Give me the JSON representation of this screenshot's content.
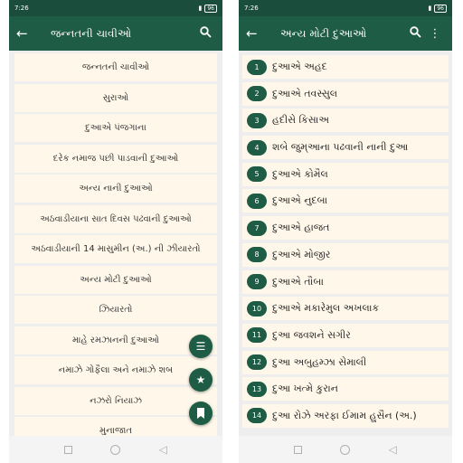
{
  "colors": {
    "primary": "#1e5c46",
    "statusbar": "#1a4d3c",
    "row_bg": "#fff8ea"
  },
  "left": {
    "status": {
      "time": "7:26",
      "battery": "96"
    },
    "title": "જન્નતની ચાવીઓ",
    "icons": {
      "back": "arrow-left-icon",
      "search": "search-icon"
    },
    "items": [
      "જન્નતની ચાવીઓ",
      "સુરાઓ",
      "દુઆએ પંજગાના",
      "દરેક નમાજ પછી પાડવાની દુઆઓ",
      "અન્ય નાની દુઆઓ",
      "અઠવાડીયાના સાત દિવસ પઢવાની દુઆઓ",
      "અઠવાડીયાની 14 માસુમીન (અ.) ની ઝીયારતો",
      "અન્ય મોટી દુઆઓ",
      "ઝિયારતો",
      "માહે રમઝાનની દુઆઓ",
      "નમાઝે ગોફૈલા અને નમાઝે શબ",
      "નઝરો નિયાઝ",
      "મુનાજાત"
    ],
    "fabs": [
      "list-icon",
      "star-icon",
      "bookmark-icon"
    ]
  },
  "right": {
    "status": {
      "time": "7:26",
      "battery": "96"
    },
    "title": "અન્ય મોટી દુઆઓ",
    "icons": {
      "back": "arrow-left-icon",
      "search": "search-icon",
      "more": "more-vert-icon"
    },
    "items": [
      {
        "num": "1",
        "label": "દુઆએ અહદ"
      },
      {
        "num": "2",
        "label": "દુઆએ તવસ્સુલ"
      },
      {
        "num": "3",
        "label": "હદીસે કિસાઅ"
      },
      {
        "num": "4",
        "label": "શબે જુમ્આના પઢવાની નાની દુઆ"
      },
      {
        "num": "5",
        "label": "દુઆએ કોમૈલ"
      },
      {
        "num": "6",
        "label": "દુઆએ નુદબા"
      },
      {
        "num": "7",
        "label": "દુઆએ હાજત"
      },
      {
        "num": "8",
        "label": "દુઆએ મોજીર"
      },
      {
        "num": "9",
        "label": "દુઆએ તૌબા"
      },
      {
        "num": "10",
        "label": "દુઆએ મકારેમુલ અખલાક"
      },
      {
        "num": "11",
        "label": "દુઆ જવશને સગીર"
      },
      {
        "num": "12",
        "label": "દુઆ અબુહમ્ઝા સેમાલી"
      },
      {
        "num": "13",
        "label": "દુઆ ખત્મે કુરાન"
      },
      {
        "num": "14",
        "label": "દુઆ રોઝે અરફા ઈમામ હુસૈન (અ.)"
      }
    ]
  }
}
